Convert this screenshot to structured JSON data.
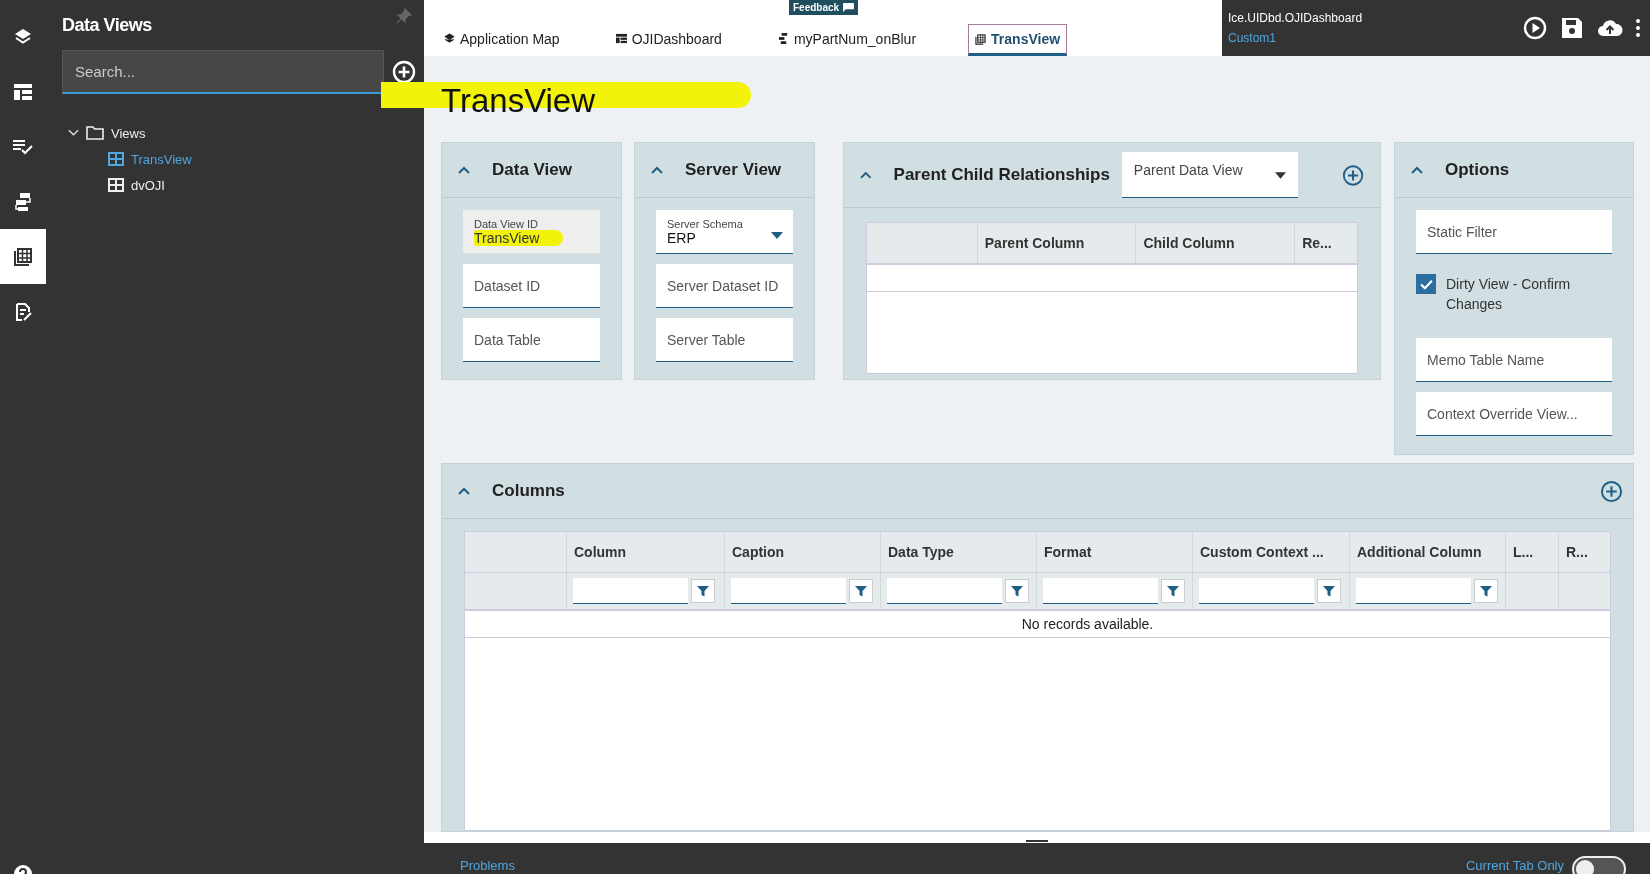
{
  "icon_rail": [
    {
      "selected": false
    },
    {
      "selected": false
    },
    {
      "selected": false
    },
    {
      "selected": false
    },
    {
      "selected": true
    },
    {
      "selected": false
    }
  ],
  "sidebar": {
    "title": "Data Views",
    "search": {
      "placeholder": "Search..."
    },
    "tree": [
      {
        "label": "Views",
        "expanded": true,
        "children": [
          {
            "label": "TransView",
            "selected": true
          },
          {
            "label": "dvOJI",
            "selected": false
          }
        ]
      }
    ]
  },
  "tabs": [
    {
      "label": "Application Map",
      "selected": false
    },
    {
      "label": "OJIDashboard",
      "selected": false
    },
    {
      "label": "myPartNum_onBlur",
      "selected": false
    },
    {
      "label": "TransView",
      "selected": true
    }
  ],
  "feedback": "Feedback",
  "header": {
    "title": "Ice.UIDbd.OJIDashboard",
    "subtitle": "Custom1"
  },
  "page_title": "TransView",
  "data_view": {
    "title": "Data View",
    "fields": [
      {
        "kind": "readonly",
        "label": "Data View ID",
        "value": "TransView"
      },
      {
        "kind": "text",
        "placeholder": "Dataset ID"
      },
      {
        "kind": "text",
        "placeholder": "Data Table"
      }
    ]
  },
  "server_view": {
    "title": "Server View",
    "fields": [
      {
        "kind": "dropdown",
        "label": "Server Schema",
        "value": "ERP"
      },
      {
        "kind": "text",
        "placeholder": "Server Dataset ID"
      },
      {
        "kind": "text",
        "placeholder": "Server Table"
      }
    ]
  },
  "parent_child": {
    "title": "Parent Child Relationships",
    "dropdown": {
      "placeholder": "Parent Data View"
    },
    "columns": [
      null,
      "Parent Column",
      "Child Column",
      "Re..."
    ]
  },
  "options": {
    "title": "Options",
    "fields": [
      {
        "kind": "text",
        "placeholder": "Static Filter"
      },
      {
        "kind": "checkbox",
        "label": "Dirty View - Confirm Changes",
        "checked": true
      },
      {
        "kind": "text",
        "placeholder": "Memo Table Name"
      },
      {
        "kind": "text",
        "placeholder": "Context Override View..."
      }
    ]
  },
  "columns_panel": {
    "title": "Columns",
    "columns": [
      {
        "filter": false
      },
      {
        "label": "Column",
        "filter": true
      },
      {
        "label": "Caption",
        "filter": true
      },
      {
        "label": "Data Type",
        "filter": true
      },
      {
        "label": "Format",
        "filter": true
      },
      {
        "label": "Custom Context ...",
        "filter": true
      },
      {
        "label": "Additional Column",
        "filter": true
      },
      {
        "label": "L...",
        "filter": false
      },
      {
        "label": "R...",
        "filter": false
      }
    ],
    "empty_message": "No records available."
  },
  "bottom_bar": {
    "problems": "Problems",
    "current_tab_only": "Current Tab Only",
    "toggle_on": false
  }
}
